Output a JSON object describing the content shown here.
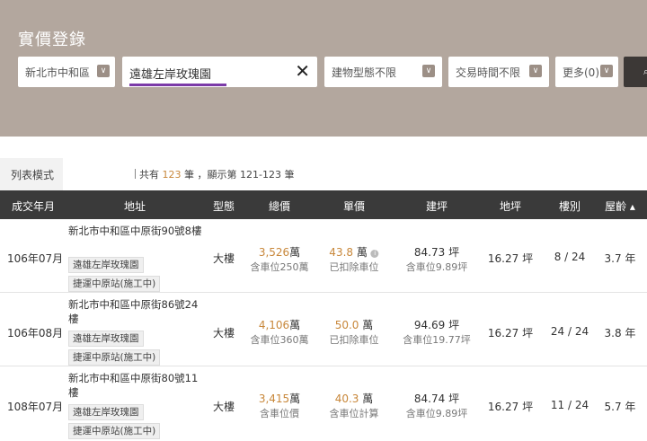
{
  "header": {
    "title": "實價登錄"
  },
  "filters": {
    "region": "新北市中和區",
    "search_value": "遠雄左岸玫瑰園",
    "building_type": "建物型態不限",
    "trade_time": "交易時間不限",
    "more": "更多(0)",
    "dropdown_glyph": "∨"
  },
  "toolbar": {
    "tab_label": "列表模式",
    "count_prefix": "共有",
    "count_total": "123",
    "count_mid": "筆 ，顯示第 121-123 筆"
  },
  "table": {
    "headers": [
      "成交年月",
      "地址",
      "型態",
      "總價",
      "單價",
      "建坪",
      "地坪",
      "樓別",
      "屋齡 ▴"
    ],
    "rows": [
      {
        "date": "106年07月",
        "address": "新北市中和區中原街90號8樓",
        "tag1": "遠雄左岸玫瑰園",
        "tag2": "捷運中原站(施工中)",
        "type": "大樓",
        "total": "3,526",
        "total_unit": "萬",
        "total_sub": "含車位250萬",
        "unit": "43.8",
        "unit_unit": "萬",
        "unit_sub": "已扣除車位",
        "bld": "84.73",
        "bld_unit": "坪",
        "bld_sub": "含車位9.89坪",
        "land": "16.27 坪",
        "floor": "8 / 24",
        "age": "3.7 年",
        "info": true
      },
      {
        "date": "106年08月",
        "address": "新北市中和區中原街86號24樓",
        "tag1": "遠雄左岸玫瑰園",
        "tag2": "捷運中原站(施工中)",
        "type": "大樓",
        "total": "4,106",
        "total_unit": "萬",
        "total_sub": "含車位360萬",
        "unit": "50.0",
        "unit_unit": "萬",
        "unit_sub": "已扣除車位",
        "bld": "94.69",
        "bld_unit": "坪",
        "bld_sub": "含車位19.77坪",
        "land": "16.27 坪",
        "floor": "24 / 24",
        "age": "3.8 年",
        "info": false
      },
      {
        "date": "108年07月",
        "address": "新北市中和區中原街80號11樓",
        "tag1": "遠雄左岸玫瑰園",
        "tag2": "捷運中原站(施工中)",
        "type": "大樓",
        "total": "3,415",
        "total_unit": "萬",
        "total_sub": "含車位價",
        "unit": "40.3",
        "unit_unit": "萬",
        "unit_sub": "含車位計算",
        "bld": "84.74",
        "bld_unit": "坪",
        "bld_sub": "含車位9.89坪",
        "land": "16.27 坪",
        "floor": "11 / 24",
        "age": "5.7 年",
        "info": false
      }
    ]
  }
}
